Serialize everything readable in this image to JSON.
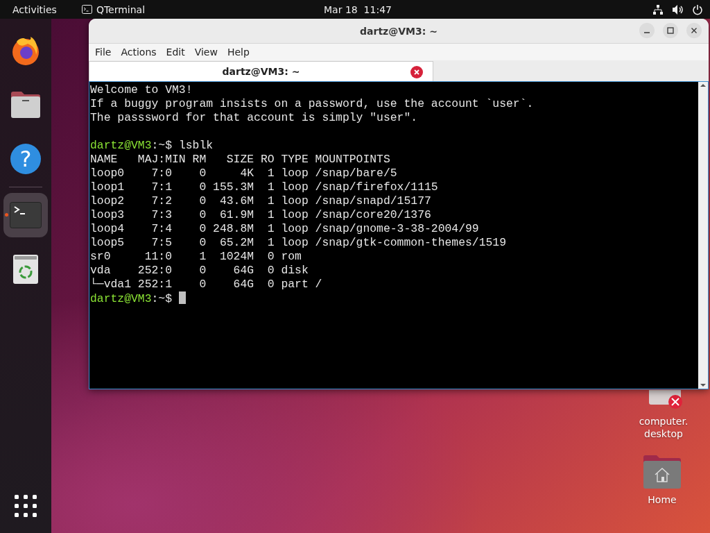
{
  "top_bar": {
    "activities": "Activities",
    "app": "QTerminal",
    "clock": "Mar 18  11:47"
  },
  "dock": {
    "items": [
      {
        "kind": "firefox",
        "active": false
      },
      {
        "kind": "files",
        "active": false
      },
      {
        "kind": "help",
        "glyph": "?",
        "active": false
      },
      {
        "kind": "separator"
      },
      {
        "kind": "terminal",
        "active": true
      },
      {
        "kind": "trash",
        "active": false
      }
    ]
  },
  "window": {
    "title": "dartz@VM3: ~",
    "menu": [
      "File",
      "Actions",
      "Edit",
      "View",
      "Help"
    ],
    "tabs": [
      {
        "label": "dartz@VM3: ~",
        "selected": true
      }
    ],
    "terminal": {
      "lines": [
        {
          "kind": "text",
          "text": "Welcome to VM3!"
        },
        {
          "kind": "text",
          "text": "If a buggy program insists on a password, use the account `user`."
        },
        {
          "kind": "text",
          "text": "The passsword for that account is simply \"user\"."
        },
        {
          "kind": "blank"
        },
        {
          "kind": "prompt",
          "user": "dartz@VM3",
          "path": ":~$",
          "command": "lsblk"
        },
        {
          "kind": "text",
          "text": "NAME   MAJ:MIN RM   SIZE RO TYPE MOUNTPOINTS"
        },
        {
          "kind": "text",
          "text": "loop0    7:0    0     4K  1 loop /snap/bare/5"
        },
        {
          "kind": "text",
          "text": "loop1    7:1    0 155.3M  1 loop /snap/firefox/1115"
        },
        {
          "kind": "text",
          "text": "loop2    7:2    0  43.6M  1 loop /snap/snapd/15177"
        },
        {
          "kind": "text",
          "text": "loop3    7:3    0  61.9M  1 loop /snap/core20/1376"
        },
        {
          "kind": "text",
          "text": "loop4    7:4    0 248.8M  1 loop /snap/gnome-3-38-2004/99"
        },
        {
          "kind": "text",
          "text": "loop5    7:5    0  65.2M  1 loop /snap/gtk-common-themes/1519"
        },
        {
          "kind": "text",
          "text": "sr0     11:0    1  1024M  0 rom"
        },
        {
          "kind": "text",
          "text": "vda    252:0    0    64G  0 disk"
        },
        {
          "kind": "text",
          "text": "└─vda1 252:1    0    64G  0 part /"
        },
        {
          "kind": "prompt",
          "user": "dartz@VM3",
          "path": ":~$",
          "cursor": true
        }
      ]
    }
  },
  "desktop_icons": [
    {
      "kind": "broken-file",
      "label": "computer.\ndesktop"
    },
    {
      "kind": "home-folder",
      "label": "Home"
    }
  ]
}
